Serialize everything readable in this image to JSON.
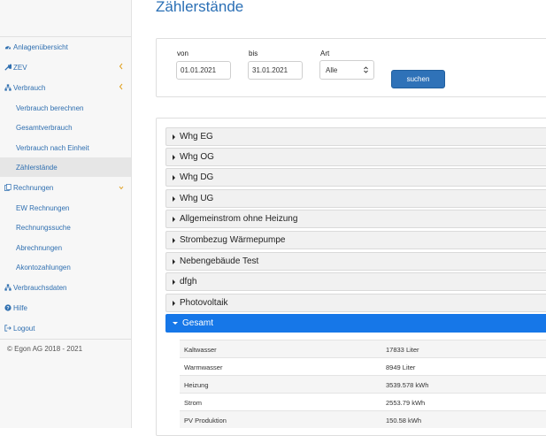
{
  "page": {
    "title": "Zählerstände"
  },
  "sidebar": {
    "items": [
      {
        "label": "Anlagenübersicht",
        "icon": "dashboard-icon",
        "level": "top"
      },
      {
        "label": "ZEV",
        "icon": "wrench-icon",
        "level": "top",
        "chevron": "left"
      },
      {
        "label": "Verbrauch",
        "icon": "sitemap-icon",
        "level": "top",
        "chevron": "left"
      },
      {
        "label": "Verbrauch berechnen",
        "level": "sub"
      },
      {
        "label": "Gesamtverbrauch",
        "level": "sub"
      },
      {
        "label": "Verbrauch nach Einheit",
        "level": "sub"
      },
      {
        "label": "Zählerstände",
        "level": "sub",
        "active": true
      },
      {
        "label": "Rechnungen",
        "icon": "copy-icon",
        "level": "top",
        "chevron": "down"
      },
      {
        "label": "EW Rechnungen",
        "level": "sub"
      },
      {
        "label": "Rechnungssuche",
        "level": "sub"
      },
      {
        "label": "Abrechnungen",
        "level": "sub"
      },
      {
        "label": "Akontozahlungen",
        "level": "sub"
      },
      {
        "label": "Verbrauchsdaten",
        "icon": "sitemap-icon",
        "level": "top"
      },
      {
        "label": "Hilfe",
        "icon": "question-icon",
        "level": "top"
      },
      {
        "label": "Logout",
        "icon": "logout-icon",
        "level": "top"
      }
    ],
    "footer": "© Egon AG 2018 - 2021"
  },
  "filter": {
    "from_label": "von",
    "from_value": "01.01.2021",
    "to_label": "bis",
    "to_value": "31.01.2021",
    "type_label": "Art",
    "type_value": "Alle",
    "search_label": "suchen"
  },
  "accordion": {
    "items": [
      {
        "label": "Whg EG",
        "open": false
      },
      {
        "label": "Whg OG",
        "open": false
      },
      {
        "label": "Whg DG",
        "open": false
      },
      {
        "label": "Whg UG",
        "open": false
      },
      {
        "label": "Allgemeinstrom ohne Heizung",
        "open": false
      },
      {
        "label": "Strombezug Wärmepumpe",
        "open": false
      },
      {
        "label": "Nebengebäude Test",
        "open": false
      },
      {
        "label": "dfgh",
        "open": false
      },
      {
        "label": "Photovoltaik",
        "open": false
      },
      {
        "label": "Gesamt",
        "open": true
      }
    ],
    "gesamt_rows": [
      {
        "name": "Kaltwasser",
        "value": "17833 Liter"
      },
      {
        "name": "Warmwasser",
        "value": "8949 Liter"
      },
      {
        "name": "Heizung",
        "value": "3539.578 kWh"
      },
      {
        "name": "Strom",
        "value": "2553.79 kWh"
      },
      {
        "name": "PV Produktion",
        "value": "150.58 kWh"
      }
    ]
  },
  "colors": {
    "accent": "#2a6fb5",
    "active_header": "#1677e8",
    "button": "#2f72b8"
  }
}
